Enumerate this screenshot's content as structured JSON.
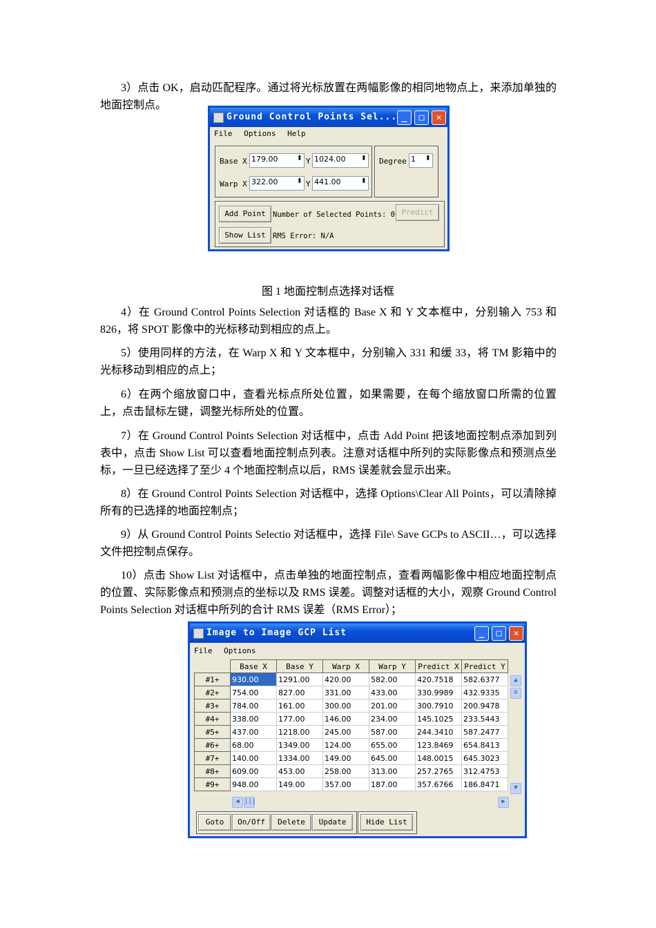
{
  "paragraphs": [
    "3）点击 OK，启动匹配程序。通过将光标放置在两幅影像的相同地物点上，来添加单独的地面控制点。",
    "4）在 Ground Control Points Selection 对话框的 Base X 和 Y 文本框中，分别输入 753 和 826，将 SPOT 影像中的光标移动到相应的点上。",
    "5）使用同样的方法，在 Warp X 和 Y 文本框中，分别输入 331 和缓 33，将 TM 影箱中的光标移动到相应的点上；",
    "6）在两个缩放窗口中，查看光标点所处位置，如果需要，在每个缩放窗口所需的位置上，点击鼠标左键，调整光标所处的位置。",
    "7）在 Ground Control Points Selection 对话框中，点击 Add Point 把该地面控制点添加到列表中，点击 Show List 可以查看地面控制点列表。注意对话框中所列的实际影像点和预测点坐标，一旦已经选择了至少 4 个地面控制点以后，RMS 误差就会显示出来。",
    "8）在 Ground Control Points Selection 对话框中，选择 Options\\Clear All Points，可以清除掉所有的已选择的地面控制点；",
    "9）从 Ground Control Points Selectio 对话框中，选择 File\\ Save GCPs to ASCII…，可以选择文件把控制点保存。",
    "10）点击 Show List 对话框中，点击单独的地面控制点，查看两幅影像中相应地面控制点的位置、实际影像点和预测点的坐标以及 RMS 误差。调整对话框的大小，观察 Ground Control Points Selection 对话框中所列的合计 RMS 误差（RMS Error）；"
  ],
  "caption": "图 1  地面控制点选择对话框",
  "gcp_dialog": {
    "title": "Ground Control Points Sel...",
    "menu": [
      "File",
      "Options",
      "Help"
    ],
    "base_label": "Base X",
    "warp_label": "Warp X",
    "y_label": "Y",
    "base_x": "179.00",
    "base_y": "1024.00",
    "warp_x": "322.00",
    "warp_y": "441.00",
    "degree_label": "Degree",
    "degree": "1",
    "add_point": "Add Point",
    "selected_points": "Number of Selected Points: 0",
    "predict": "Predict",
    "show_list": "Show List",
    "rms": "RMS Error: N/A"
  },
  "list_dialog": {
    "title": "Image to Image GCP List",
    "menu": [
      "File",
      "Options"
    ],
    "columns": [
      "Base X",
      "Base Y",
      "Warp X",
      "Warp Y",
      "Predict X",
      "Predict Y"
    ],
    "rows": [
      {
        "id": "#1+",
        "cells": [
          "930.00",
          "1291.00",
          "420.00",
          "582.00",
          "420.7518",
          "582.6377"
        ]
      },
      {
        "id": "#2+",
        "cells": [
          "754.00",
          "827.00",
          "331.00",
          "433.00",
          "330.9989",
          "432.9335"
        ]
      },
      {
        "id": "#3+",
        "cells": [
          "784.00",
          "161.00",
          "300.00",
          "201.00",
          "300.7910",
          "200.9478"
        ]
      },
      {
        "id": "#4+",
        "cells": [
          "338.00",
          "177.00",
          "146.00",
          "234.00",
          "145.1025",
          "233.5443"
        ]
      },
      {
        "id": "#5+",
        "cells": [
          "437.00",
          "1218.00",
          "245.00",
          "587.00",
          "244.3410",
          "587.2477"
        ]
      },
      {
        "id": "#6+",
        "cells": [
          "68.00",
          "1349.00",
          "124.00",
          "655.00",
          "123.8469",
          "654.8413"
        ]
      },
      {
        "id": "#7+",
        "cells": [
          "140.00",
          "1334.00",
          "149.00",
          "645.00",
          "148.0015",
          "645.3023"
        ]
      },
      {
        "id": "#8+",
        "cells": [
          "609.00",
          "453.00",
          "258.00",
          "313.00",
          "257.2765",
          "312.4753"
        ]
      },
      {
        "id": "#9+",
        "cells": [
          "948.00",
          "149.00",
          "357.00",
          "187.00",
          "357.6766",
          "186.8471"
        ]
      }
    ],
    "buttons": [
      "Goto",
      "On/Off",
      "Delete",
      "Update",
      "Hide List"
    ]
  }
}
